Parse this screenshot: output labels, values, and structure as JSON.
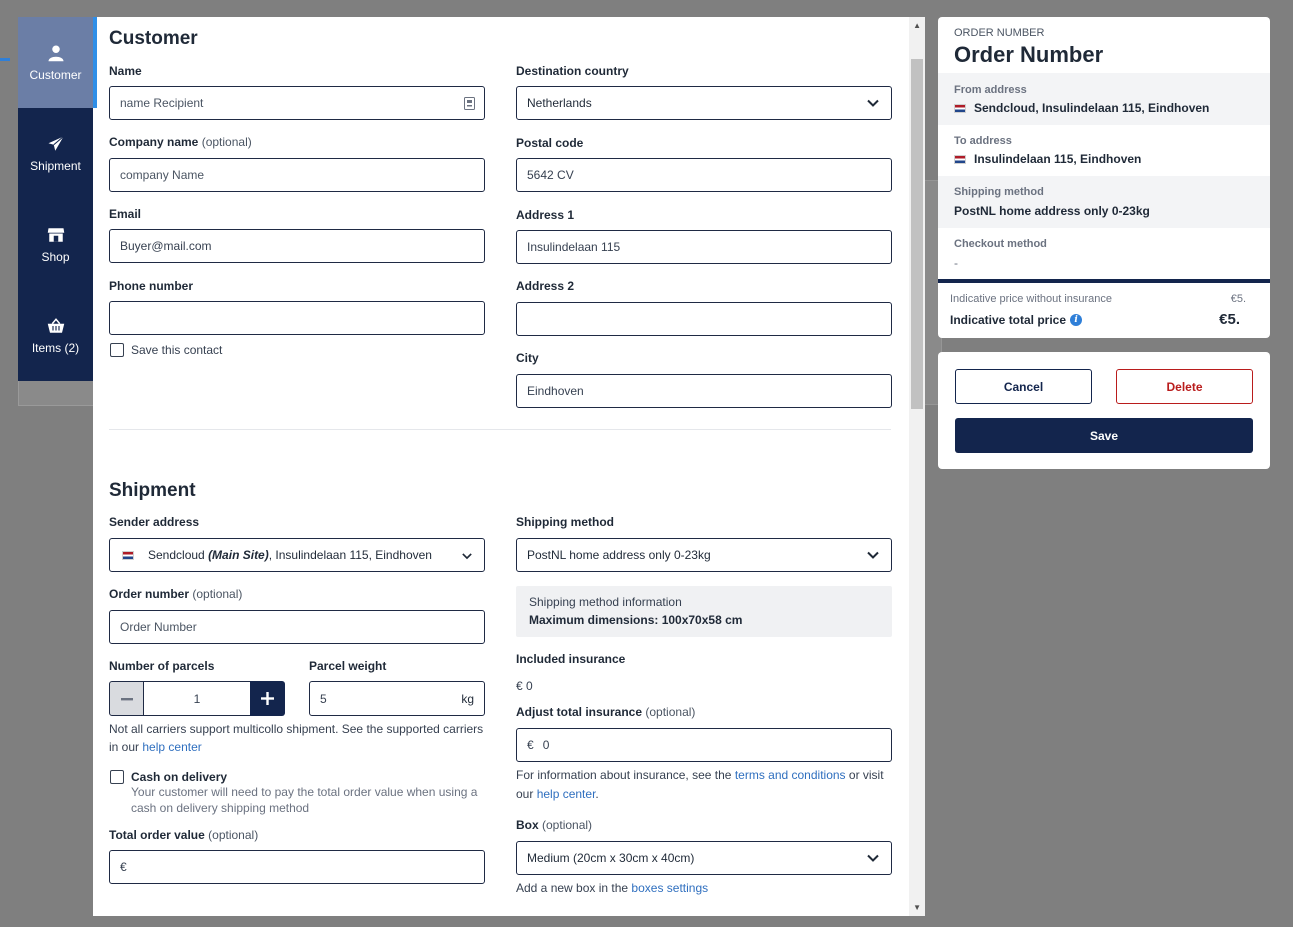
{
  "nav": {
    "items": [
      {
        "label": "Customer",
        "icon": "user-icon"
      },
      {
        "label": "Shipment",
        "icon": "paper-plane-icon"
      },
      {
        "label": "Shop",
        "icon": "store-icon"
      },
      {
        "label": "Items (2)",
        "icon": "basket-icon"
      }
    ]
  },
  "customer": {
    "title": "Customer",
    "name_label": "Name",
    "name_placeholder": "name Recipient",
    "company_label": "Company name",
    "company_optional": "(optional)",
    "company_placeholder": "company Name",
    "email_label": "Email",
    "email_value": "Buyer@mail.com",
    "phone_label": "Phone number",
    "save_contact_label": "Save this contact",
    "country_label": "Destination country",
    "country_value": "Netherlands",
    "postal_label": "Postal code",
    "postal_value": "5642 CV",
    "address1_label": "Address 1",
    "address1_value": "Insulindelaan 115",
    "address2_label": "Address 2",
    "city_label": "City",
    "city_value": "Eindhoven"
  },
  "shipment": {
    "title": "Shipment",
    "sender_label": "Sender address",
    "sender_name": "Sendcloud",
    "sender_site": "(Main Site)",
    "sender_address": ", Insulindelaan 115, Eindhoven",
    "order_label": "Order number",
    "order_optional": "(optional)",
    "order_placeholder": "Order Number",
    "parcels_label": "Number of parcels",
    "parcels_value": "1",
    "weight_label": "Parcel weight",
    "weight_value": "5",
    "weight_unit": "kg",
    "multicollo_note": "Not all carriers support multicollo shipment. See the supported carriers in our",
    "multicollo_link": "help center",
    "cod_label": "Cash on delivery",
    "cod_note": "Your customer will need to pay the total order value when using a cash on delivery shipping method",
    "total_label": "Total order value",
    "total_optional": "(optional)",
    "total_currency": "€",
    "method_label": "Shipping method",
    "method_value": "PostNL home address only 0-23kg",
    "method_info_title": "Shipping method information",
    "method_info_dims": "Maximum dimensions: 100x70x58 cm",
    "included_ins_label": "Included insurance",
    "included_ins_value": "€ 0",
    "adjust_ins_label": "Adjust total insurance",
    "adjust_ins_optional": "(optional)",
    "adjust_ins_currency": "€",
    "adjust_ins_value": "0",
    "ins_note_prefix": "For information about insurance, see the",
    "ins_note_link1": "terms and conditions",
    "ins_note_mid": "or visit our",
    "ins_note_link2": "help center",
    "ins_note_suffix": ".",
    "box_label": "Box",
    "box_optional": "(optional)",
    "box_value": "Medium (20cm x 30cm x 40cm)",
    "box_note": "Add a new box in the",
    "box_note_link": "boxes settings"
  },
  "summary": {
    "eyebrow": "ORDER NUMBER",
    "title": "Order Number",
    "from_label": "From address",
    "from_value": "Sendcloud, Insulindelaan 115, Eindhoven",
    "to_label": "To address",
    "to_value": "Insulindelaan 115, Eindhoven",
    "method_label": "Shipping method",
    "method_value": "PostNL home address only 0-23kg",
    "checkout_label": "Checkout method",
    "checkout_value": "-",
    "price_no_ins_label": "Indicative price without insurance",
    "price_no_ins_value": "€5.",
    "total_label": "Indicative total price",
    "total_value": "€5."
  },
  "actions": {
    "cancel": "Cancel",
    "delete": "Delete",
    "save": "Save"
  },
  "colors": {
    "navy": "#13254d",
    "accent_blue": "#2f8fe8",
    "delete_red": "#b91c1c",
    "link": "#2f6fbf"
  }
}
